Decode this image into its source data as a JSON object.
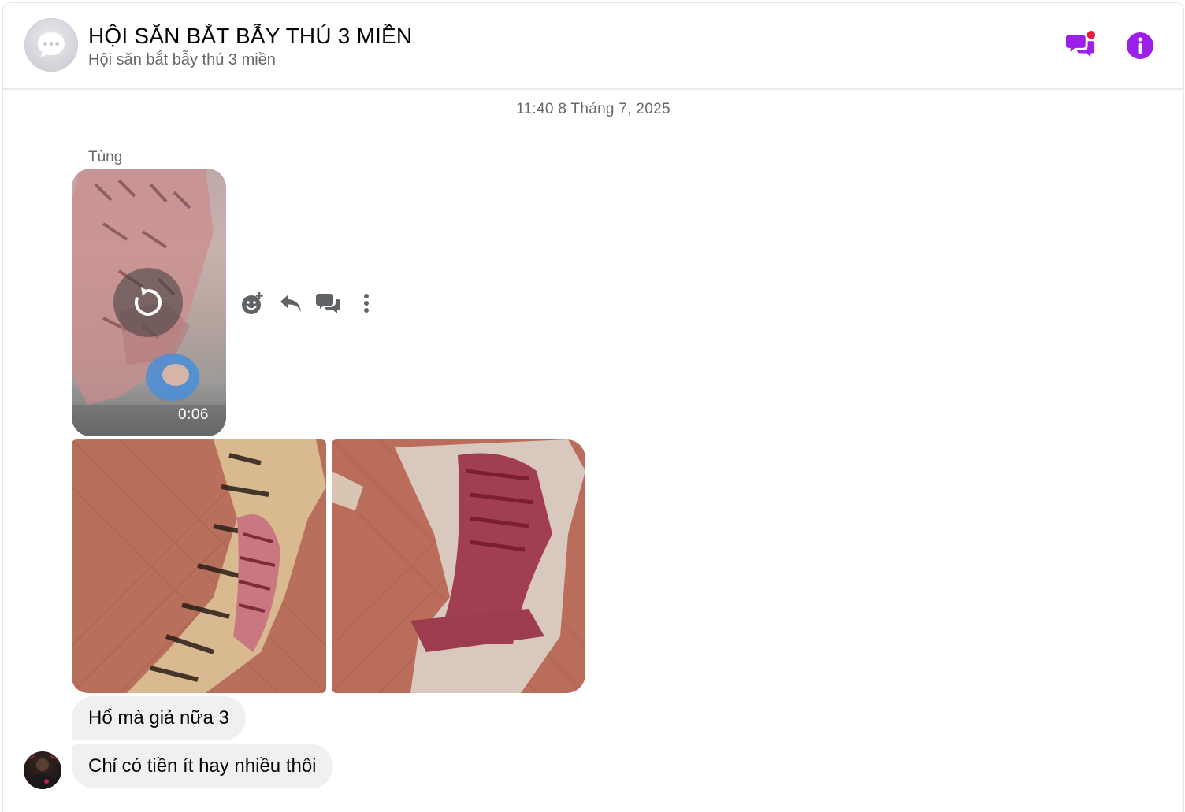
{
  "header": {
    "title": "HỘI SĂN BẮT BẪY THÚ 3 MIỀN",
    "subtitle": "Hội săn bắt bẫy thú 3 miền",
    "accent_color": "#9b1fe8",
    "notification_dot_color": "#e41e3f",
    "icons": [
      "chat-bubble-icon",
      "threads-icon",
      "info-icon"
    ]
  },
  "conversation": {
    "timestamp": "11:40 8 Tháng 7, 2025",
    "sender_name": "Tùng",
    "video": {
      "duration": "0:06",
      "icon": "replay-icon"
    },
    "message_actions": [
      "react-emoji-icon",
      "reply-icon",
      "forward-icon",
      "more-icon"
    ],
    "photos": [
      "photo-1",
      "photo-2"
    ],
    "messages": [
      {
        "text": "Hổ mà giả nữa 3"
      },
      {
        "text": "Chỉ có tiền ít hay nhiều thôi"
      }
    ]
  }
}
